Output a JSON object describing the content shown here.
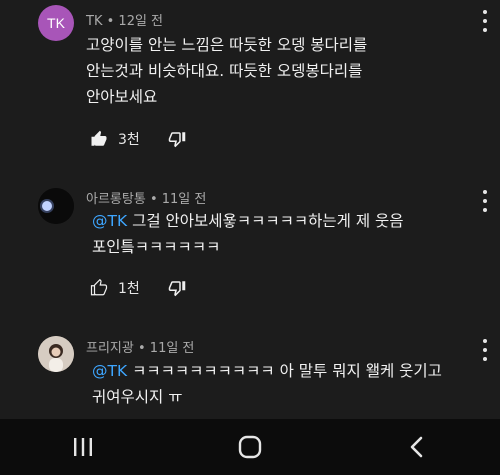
{
  "comments": [
    {
      "avatar_text": "TK",
      "author": "TK",
      "time": "12일 전",
      "lines": [
        "고양이를 안는 느낌은 따듯한 오뎅 봉다리를",
        "안는것과 비슷하대요. 따듯한 오뎅봉다리를",
        "안아보세요"
      ],
      "likes": "3천"
    },
    {
      "author": "아르롱탕통",
      "time": "11일 전",
      "mention": "@TK",
      "lines": [
        "그걸 안아보세욯ㅋㅋㅋㅋㅋ하는게 제 웃음",
        "포인틐ㅋㅋㅋㅋㅋㅋ"
      ],
      "likes": "1천"
    },
    {
      "author": "프리지광",
      "time": "11일 전",
      "mention": "@TK",
      "lines": [
        "ㅋㅋㅋㅋㅋㅋㅋㅋㅋㅋ 아 말투 뭐지 왤케 웃기고",
        "귀여우시지 ㅠ"
      ]
    }
  ],
  "separator": "•",
  "icons": {
    "like": "thumbs-up-icon",
    "dislike": "thumbs-down-icon",
    "more": "more-vert-icon",
    "nav": [
      "recent-apps-icon",
      "home-icon",
      "back-icon"
    ]
  },
  "colors": {
    "background": "#1c1c1c",
    "mention": "#3ea6ff",
    "avatar_tk": "#a855b8"
  }
}
